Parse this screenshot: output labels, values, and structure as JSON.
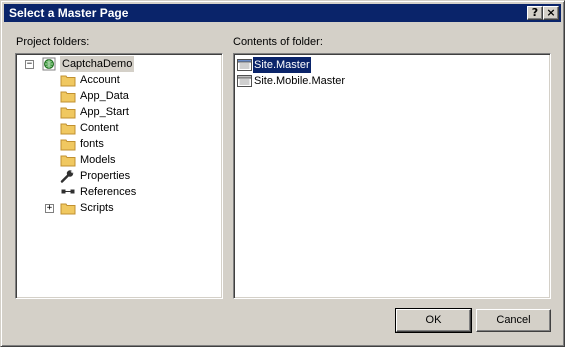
{
  "window": {
    "title": "Select a Master Page",
    "help_glyph": "?",
    "close_glyph": "×"
  },
  "left": {
    "label": "Project folders:",
    "tree": {
      "root": {
        "label": "CaptchaDemo",
        "icon": "web-project-icon",
        "expanded": true
      },
      "children": [
        {
          "label": "Account",
          "icon": "folder-icon"
        },
        {
          "label": "App_Data",
          "icon": "folder-icon"
        },
        {
          "label": "App_Start",
          "icon": "folder-icon"
        },
        {
          "label": "Content",
          "icon": "folder-icon"
        },
        {
          "label": "fonts",
          "icon": "folder-icon"
        },
        {
          "label": "Models",
          "icon": "folder-icon"
        },
        {
          "label": "Properties",
          "icon": "wrench-icon"
        },
        {
          "label": "References",
          "icon": "references-icon"
        },
        {
          "label": "Scripts",
          "icon": "folder-icon",
          "collapsed": true
        }
      ]
    }
  },
  "right": {
    "label": "Contents of folder:",
    "files": [
      {
        "label": "Site.Master",
        "icon": "master-page-icon",
        "selected": true
      },
      {
        "label": "Site.Mobile.Master",
        "icon": "master-page-icon",
        "selected": false
      }
    ]
  },
  "buttons": {
    "ok": "OK",
    "cancel": "Cancel"
  },
  "colors": {
    "dialog_face": "#d4d0c8",
    "titlebar": "#0a246a",
    "selection": "#0a246a",
    "folder": "#f0c860"
  }
}
